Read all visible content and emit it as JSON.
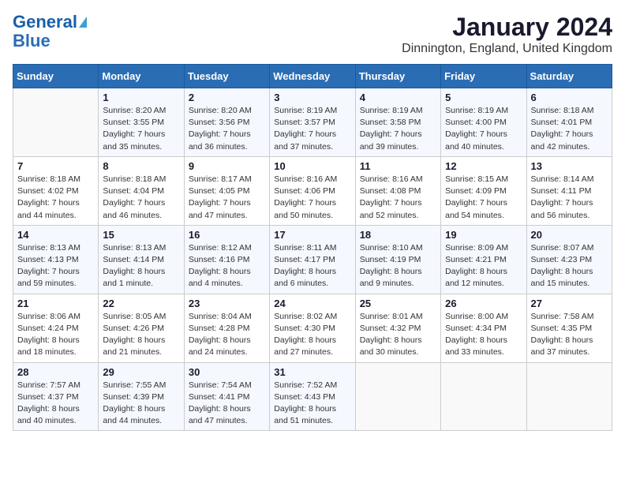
{
  "header": {
    "logo_line1": "General",
    "logo_line2": "Blue",
    "month": "January 2024",
    "location": "Dinnington, England, United Kingdom"
  },
  "weekdays": [
    "Sunday",
    "Monday",
    "Tuesday",
    "Wednesday",
    "Thursday",
    "Friday",
    "Saturday"
  ],
  "weeks": [
    [
      {
        "day": "",
        "sunrise": "",
        "sunset": "",
        "daylight": ""
      },
      {
        "day": "1",
        "sunrise": "Sunrise: 8:20 AM",
        "sunset": "Sunset: 3:55 PM",
        "daylight": "Daylight: 7 hours and 35 minutes."
      },
      {
        "day": "2",
        "sunrise": "Sunrise: 8:20 AM",
        "sunset": "Sunset: 3:56 PM",
        "daylight": "Daylight: 7 hours and 36 minutes."
      },
      {
        "day": "3",
        "sunrise": "Sunrise: 8:19 AM",
        "sunset": "Sunset: 3:57 PM",
        "daylight": "Daylight: 7 hours and 37 minutes."
      },
      {
        "day": "4",
        "sunrise": "Sunrise: 8:19 AM",
        "sunset": "Sunset: 3:58 PM",
        "daylight": "Daylight: 7 hours and 39 minutes."
      },
      {
        "day": "5",
        "sunrise": "Sunrise: 8:19 AM",
        "sunset": "Sunset: 4:00 PM",
        "daylight": "Daylight: 7 hours and 40 minutes."
      },
      {
        "day": "6",
        "sunrise": "Sunrise: 8:18 AM",
        "sunset": "Sunset: 4:01 PM",
        "daylight": "Daylight: 7 hours and 42 minutes."
      }
    ],
    [
      {
        "day": "7",
        "sunrise": "Sunrise: 8:18 AM",
        "sunset": "Sunset: 4:02 PM",
        "daylight": "Daylight: 7 hours and 44 minutes."
      },
      {
        "day": "8",
        "sunrise": "Sunrise: 8:18 AM",
        "sunset": "Sunset: 4:04 PM",
        "daylight": "Daylight: 7 hours and 46 minutes."
      },
      {
        "day": "9",
        "sunrise": "Sunrise: 8:17 AM",
        "sunset": "Sunset: 4:05 PM",
        "daylight": "Daylight: 7 hours and 47 minutes."
      },
      {
        "day": "10",
        "sunrise": "Sunrise: 8:16 AM",
        "sunset": "Sunset: 4:06 PM",
        "daylight": "Daylight: 7 hours and 50 minutes."
      },
      {
        "day": "11",
        "sunrise": "Sunrise: 8:16 AM",
        "sunset": "Sunset: 4:08 PM",
        "daylight": "Daylight: 7 hours and 52 minutes."
      },
      {
        "day": "12",
        "sunrise": "Sunrise: 8:15 AM",
        "sunset": "Sunset: 4:09 PM",
        "daylight": "Daylight: 7 hours and 54 minutes."
      },
      {
        "day": "13",
        "sunrise": "Sunrise: 8:14 AM",
        "sunset": "Sunset: 4:11 PM",
        "daylight": "Daylight: 7 hours and 56 minutes."
      }
    ],
    [
      {
        "day": "14",
        "sunrise": "Sunrise: 8:13 AM",
        "sunset": "Sunset: 4:13 PM",
        "daylight": "Daylight: 7 hours and 59 minutes."
      },
      {
        "day": "15",
        "sunrise": "Sunrise: 8:13 AM",
        "sunset": "Sunset: 4:14 PM",
        "daylight": "Daylight: 8 hours and 1 minute."
      },
      {
        "day": "16",
        "sunrise": "Sunrise: 8:12 AM",
        "sunset": "Sunset: 4:16 PM",
        "daylight": "Daylight: 8 hours and 4 minutes."
      },
      {
        "day": "17",
        "sunrise": "Sunrise: 8:11 AM",
        "sunset": "Sunset: 4:17 PM",
        "daylight": "Daylight: 8 hours and 6 minutes."
      },
      {
        "day": "18",
        "sunrise": "Sunrise: 8:10 AM",
        "sunset": "Sunset: 4:19 PM",
        "daylight": "Daylight: 8 hours and 9 minutes."
      },
      {
        "day": "19",
        "sunrise": "Sunrise: 8:09 AM",
        "sunset": "Sunset: 4:21 PM",
        "daylight": "Daylight: 8 hours and 12 minutes."
      },
      {
        "day": "20",
        "sunrise": "Sunrise: 8:07 AM",
        "sunset": "Sunset: 4:23 PM",
        "daylight": "Daylight: 8 hours and 15 minutes."
      }
    ],
    [
      {
        "day": "21",
        "sunrise": "Sunrise: 8:06 AM",
        "sunset": "Sunset: 4:24 PM",
        "daylight": "Daylight: 8 hours and 18 minutes."
      },
      {
        "day": "22",
        "sunrise": "Sunrise: 8:05 AM",
        "sunset": "Sunset: 4:26 PM",
        "daylight": "Daylight: 8 hours and 21 minutes."
      },
      {
        "day": "23",
        "sunrise": "Sunrise: 8:04 AM",
        "sunset": "Sunset: 4:28 PM",
        "daylight": "Daylight: 8 hours and 24 minutes."
      },
      {
        "day": "24",
        "sunrise": "Sunrise: 8:02 AM",
        "sunset": "Sunset: 4:30 PM",
        "daylight": "Daylight: 8 hours and 27 minutes."
      },
      {
        "day": "25",
        "sunrise": "Sunrise: 8:01 AM",
        "sunset": "Sunset: 4:32 PM",
        "daylight": "Daylight: 8 hours and 30 minutes."
      },
      {
        "day": "26",
        "sunrise": "Sunrise: 8:00 AM",
        "sunset": "Sunset: 4:34 PM",
        "daylight": "Daylight: 8 hours and 33 minutes."
      },
      {
        "day": "27",
        "sunrise": "Sunrise: 7:58 AM",
        "sunset": "Sunset: 4:35 PM",
        "daylight": "Daylight: 8 hours and 37 minutes."
      }
    ],
    [
      {
        "day": "28",
        "sunrise": "Sunrise: 7:57 AM",
        "sunset": "Sunset: 4:37 PM",
        "daylight": "Daylight: 8 hours and 40 minutes."
      },
      {
        "day": "29",
        "sunrise": "Sunrise: 7:55 AM",
        "sunset": "Sunset: 4:39 PM",
        "daylight": "Daylight: 8 hours and 44 minutes."
      },
      {
        "day": "30",
        "sunrise": "Sunrise: 7:54 AM",
        "sunset": "Sunset: 4:41 PM",
        "daylight": "Daylight: 8 hours and 47 minutes."
      },
      {
        "day": "31",
        "sunrise": "Sunrise: 7:52 AM",
        "sunset": "Sunset: 4:43 PM",
        "daylight": "Daylight: 8 hours and 51 minutes."
      },
      {
        "day": "",
        "sunrise": "",
        "sunset": "",
        "daylight": ""
      },
      {
        "day": "",
        "sunrise": "",
        "sunset": "",
        "daylight": ""
      },
      {
        "day": "",
        "sunrise": "",
        "sunset": "",
        "daylight": ""
      }
    ]
  ]
}
